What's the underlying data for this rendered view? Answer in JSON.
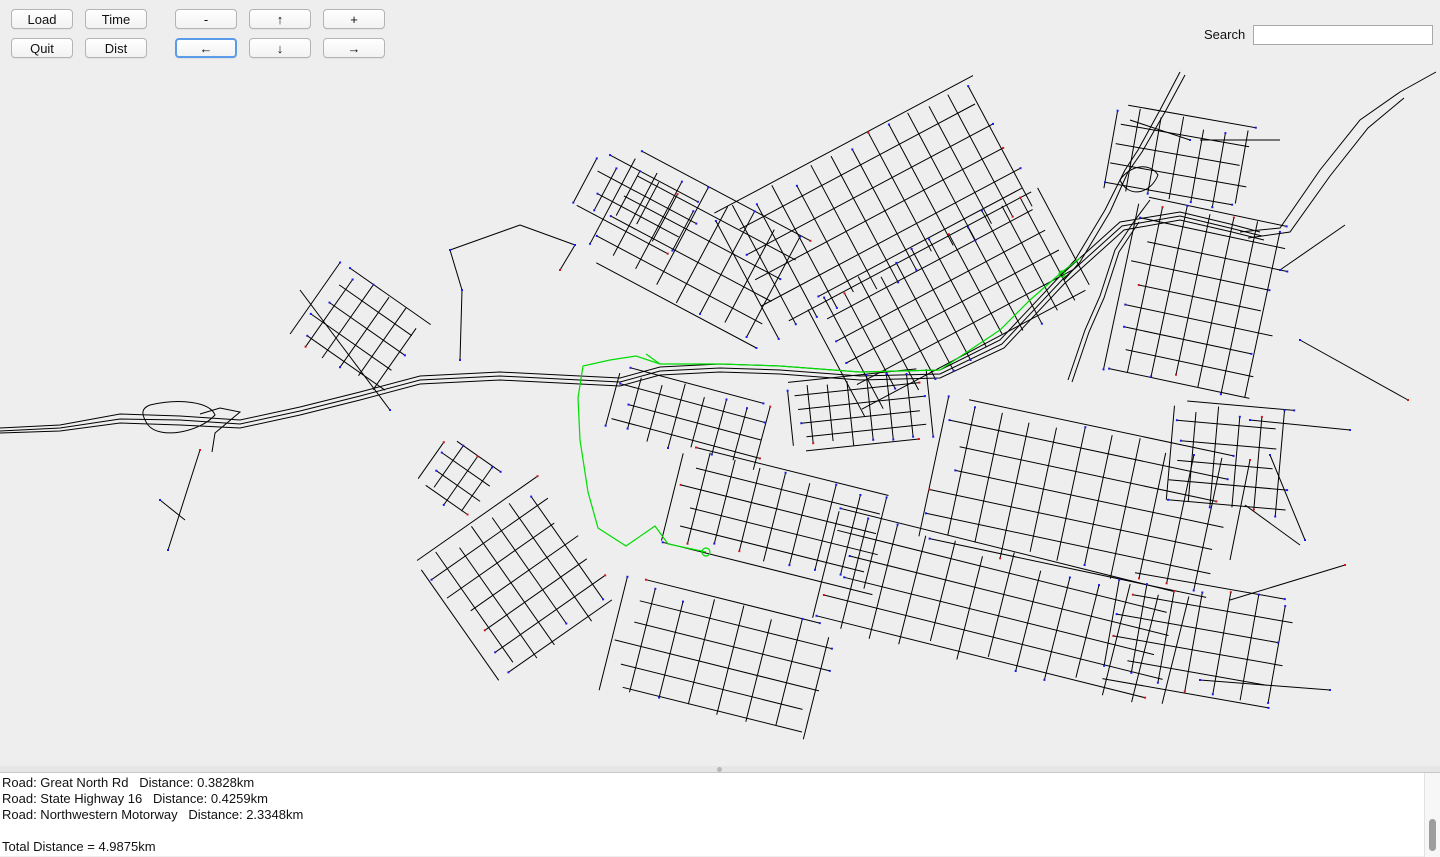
{
  "toolbar": {
    "load": "Load",
    "time": "Time",
    "quit": "Quit",
    "dist": "Dist",
    "zoom_out": "-",
    "up": "↑",
    "zoom_in": "+",
    "left": "←",
    "down": "↓",
    "right": "→"
  },
  "search": {
    "label": "Search",
    "value": ""
  },
  "colors": {
    "road": "#000000",
    "route": "#00dd00",
    "node_blue": "#1c1ce6",
    "node_red": "#d01818",
    "background": "#eeeeee"
  },
  "output": {
    "lines": [
      "Road: Great North Rd   Distance: 0.3828km",
      "Road: State Highway 16   Distance: 0.4259km",
      "Road: Northwestern Motorway   Distance: 2.3348km",
      "",
      "Total Distance = 4.9875km"
    ]
  }
}
